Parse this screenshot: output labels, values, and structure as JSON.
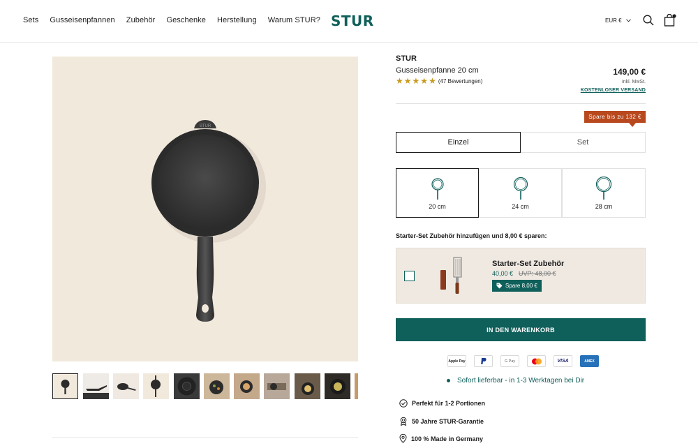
{
  "header": {
    "nav": [
      "Sets",
      "Gusseisenpfannen",
      "Zubehör",
      "Geschenke",
      "Herstellung",
      "Warum STUR?"
    ],
    "logo": "STUR",
    "currency": "EUR €"
  },
  "product": {
    "brand": "STUR",
    "title": "Gusseisenpfanne 20 cm",
    "rating": {
      "stars": 5,
      "count_text": "(47 Bewertungen)"
    },
    "price": "149,00 €",
    "tax": "inkl. MwSt.",
    "shipping": "KOSTENLOSER VERSAND",
    "save_badge": "Spare bis zu 132 €",
    "options": {
      "einzel": "Einzel",
      "set": "Set",
      "selected": "Einzel"
    },
    "sizes": [
      "20 cm",
      "24 cm",
      "28 cm"
    ],
    "selected_size": "20 cm",
    "upsell": {
      "heading": "Starter-Set Zubehör hinzufügen und 8,00 € sparen:",
      "name": "Starter-Set Zubehör",
      "price": "40,00 €",
      "old_price": "UVP: 48,00 €",
      "save": "Spare 8,00 €",
      "checked": false
    },
    "cart_label": "IN DEN WARENKORB",
    "payments": [
      "Apple Pay",
      "PayPal",
      "G Pay",
      "Mastercard",
      "VISA",
      "AMEX"
    ],
    "delivery": "Sofort lieferbar - in 1-3 Werktagen bei Dir",
    "features": [
      "Perfekt für 1-2 Portionen",
      "50 Jahre STUR-Garantie",
      "100 % Made in Germany"
    ]
  },
  "gallery": {
    "thumb_count": 11,
    "active_index": 0,
    "pan_stamp": "STUR"
  },
  "colors": {
    "brand": "#0f5f5a",
    "badge": "#b8481d",
    "image_bg": "#f2e9dd",
    "star": "#c79b20"
  }
}
